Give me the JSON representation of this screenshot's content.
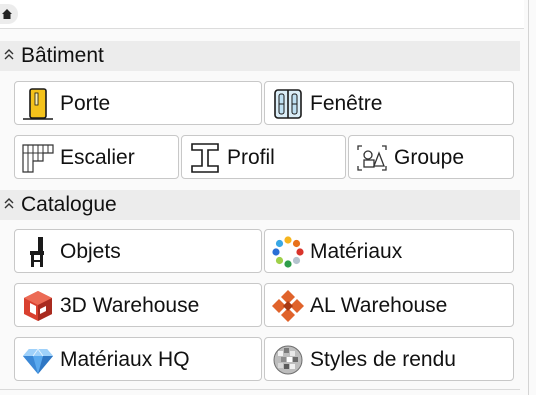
{
  "sections": {
    "batiment": {
      "title": "Bâtiment"
    },
    "catalogue": {
      "title": "Catalogue"
    }
  },
  "buttons": {
    "porte": {
      "label": "Porte",
      "icon": "door-icon"
    },
    "fenetre": {
      "label": "Fenêtre",
      "icon": "window-icon"
    },
    "escalier": {
      "label": "Escalier",
      "icon": "stairs-icon"
    },
    "profil": {
      "label": "Profil",
      "icon": "i-beam-profile-icon"
    },
    "groupe": {
      "label": "Groupe",
      "icon": "group-icon"
    },
    "objets": {
      "label": "Objets",
      "icon": "chair-icon"
    },
    "materiaux": {
      "label": "Matériaux",
      "icon": "color-wheel-icon"
    },
    "warehouse3d": {
      "label": "3D Warehouse",
      "icon": "3d-warehouse-icon"
    },
    "alwarehouse": {
      "label": "AL Warehouse",
      "icon": "al-warehouse-icon"
    },
    "materiauxhq": {
      "label": "Matériaux HQ",
      "icon": "diamond-icon"
    },
    "styles": {
      "label": "Styles de rendu",
      "icon": "disco-ball-icon"
    }
  },
  "colors": {
    "section_bg": "#ececec",
    "button_border": "#c8c8c8",
    "warehouse_red": "#d9402f",
    "al_orange": "#e0632b",
    "door_yellow": "#f4c21b",
    "diamond_blue": "#5aa9ee"
  }
}
